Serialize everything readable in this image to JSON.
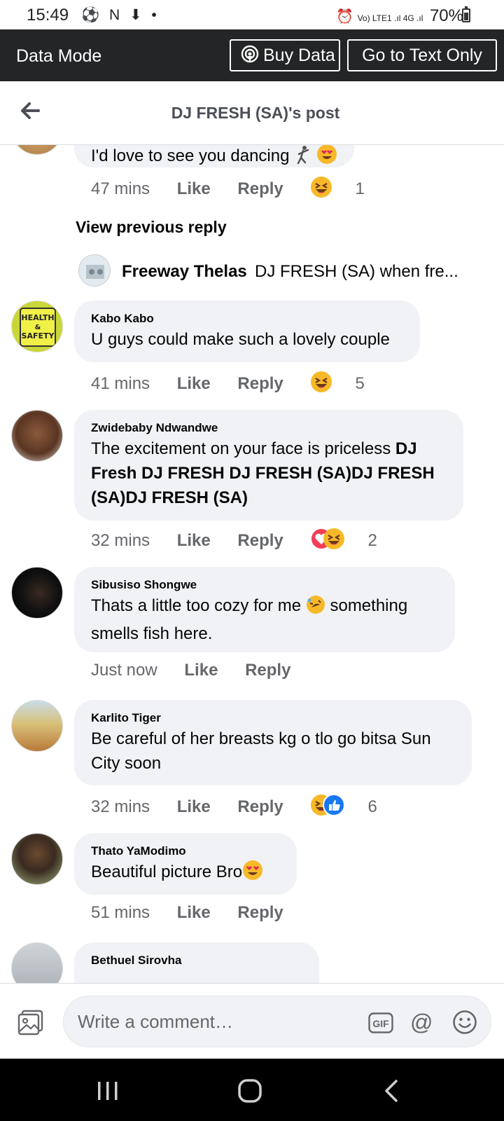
{
  "status_bar": {
    "time": "15:49",
    "left_icons": "⚽ N ⬇ •",
    "network": "Vo) LTE1 .ıl 4G .ıl",
    "battery": "70%"
  },
  "data_mode_bar": {
    "title": "Data Mode",
    "buy_data_label": "Buy Data",
    "text_only_label": "Go to Text Only"
  },
  "header": {
    "title": "DJ FRESH  (SA)'s post"
  },
  "feed": {
    "partial_comment": {
      "text": "I'd love to see you dancing",
      "time": "47 mins",
      "like": "Like",
      "reply": "Reply",
      "reaction_count": "1"
    },
    "view_previous_reply": "View previous reply",
    "reply_preview": {
      "name": "Freeway Thelas",
      "text": "DJ FRESH  (SA) when fre..."
    },
    "comments": [
      {
        "author": "Kabo Kabo",
        "text": "U guys could make such a lovely couple",
        "time": "41 mins",
        "like": "Like",
        "reply": "Reply",
        "reaction_count": "5"
      },
      {
        "author": "Zwidebaby  Ndwandwe",
        "text": "The excitement on your face is priceless ",
        "mentions": "DJ Fresh DJ FRESH  DJ FRESH  (SA)DJ FRESH  (SA)DJ FRESH  (SA)",
        "time": "32 mins",
        "like": "Like",
        "reply": "Reply",
        "reaction_count": "2"
      },
      {
        "author": "Sibusiso Shongwe",
        "text_before": "Thats a little too cozy for me ",
        "text_after": " something smells fish here.",
        "time": "Just now",
        "like": "Like",
        "reply": "Reply"
      },
      {
        "author": "Karlito Tiger",
        "text": "Be careful of her breasts kg o tlo go bitsa Sun City soon",
        "time": "32 mins",
        "like": "Like",
        "reply": "Reply",
        "reaction_count": "6"
      },
      {
        "author": "Thato YaModimo",
        "text": "Beautiful picture Bro",
        "time": "51 mins",
        "like": "Like",
        "reply": "Reply"
      },
      {
        "author": "Bethuel Sirovha"
      }
    ]
  },
  "composer": {
    "placeholder": "Write a comment…",
    "gif_label": "GIF",
    "at_label": "@"
  },
  "colors": {
    "bubble": "#f0f2f5",
    "meta_text": "#65676b",
    "data_bar": "#242526",
    "haha_yellow": "#f7b928",
    "love_red": "#f33e58",
    "like_blue": "#1877f2"
  },
  "icons": [
    "back-arrow-icon",
    "podcast-icon",
    "photo-icon",
    "gif-icon",
    "at-icon",
    "smiley-icon",
    "haha-reaction-icon",
    "love-reaction-icon",
    "like-reaction-icon",
    "heart-eyes-emoji",
    "rofl-emoji",
    "dancer-emoji"
  ]
}
